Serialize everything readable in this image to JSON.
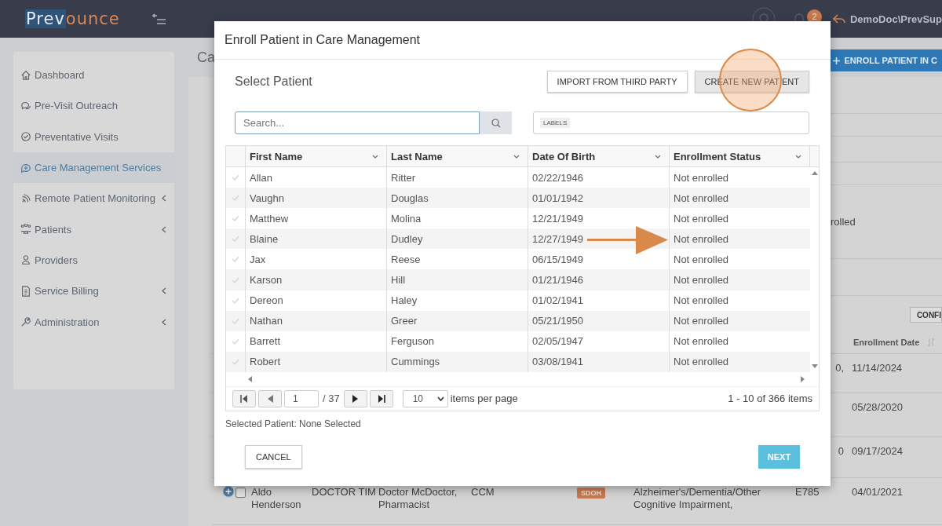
{
  "header": {
    "logo": {
      "part_1": "Prev",
      "part_2": "ounce"
    },
    "notifications": "2",
    "user": "DemoDoc\\PrevSup"
  },
  "sidebar": {
    "items": [
      {
        "label": "Dashboard",
        "expandable": false,
        "selected": false
      },
      {
        "label": "Pre-Visit Outreach",
        "expandable": false,
        "selected": false
      },
      {
        "label": "Preventative Visits",
        "expandable": false,
        "selected": false
      },
      {
        "label": "Care Management Services",
        "expandable": false,
        "selected": true
      },
      {
        "label": "Remote Patient Monitoring",
        "expandable": true,
        "selected": false
      },
      {
        "label": "Patients",
        "expandable": true,
        "selected": false
      },
      {
        "label": "Providers",
        "expandable": false,
        "selected": false
      },
      {
        "label": "Service Billing",
        "expandable": true,
        "selected": false
      },
      {
        "label": "Administration",
        "expandable": true,
        "selected": false
      }
    ]
  },
  "page": {
    "title": "Ca",
    "enroll_button": "ENROLL PATIENT IN C",
    "status_fragment": "rolled",
    "config_button": "CONFI",
    "table": {
      "date_header": "Enrollment Date",
      "rows": [
        {
          "code": "0,",
          "date": "11/14/2024"
        },
        {
          "date": "05/28/2020"
        },
        {
          "code": "0",
          "date": "09/17/2024"
        },
        {
          "checked": false,
          "name": "Aldo Henderson",
          "doctor": "DOCTOR TIM",
          "providers": "Doctor McDoctor, Pharmacist",
          "program": "CCM",
          "tag": "SDOH",
          "condition": "Alzheimer's/Dementia/Other Cognitive Impairment,",
          "code": "E785",
          "date": "04/01/2021"
        }
      ]
    }
  },
  "modal": {
    "title": "Enroll Patient in Care Management",
    "section_title": "Select Patient",
    "import_button": "IMPORT FROM THIRD PARTY",
    "create_button": "CREATE NEW PATIENT",
    "search": {
      "placeholder": "Search..."
    },
    "labels_chip": "LABELS",
    "grid": {
      "columns": [
        "First Name",
        "Last Name",
        "Date Of Birth",
        "Enrollment Status"
      ],
      "rows": [
        {
          "first_name": "Allan",
          "last_name": "Ritter",
          "dob": "02/22/1946",
          "status": "Not enrolled",
          "selected": false
        },
        {
          "first_name": "Vaughn",
          "last_name": "Douglas",
          "dob": "01/01/1942",
          "status": "Not enrolled",
          "selected": false
        },
        {
          "first_name": "Matthew",
          "last_name": "Molina",
          "dob": "12/21/1949",
          "status": "Not enrolled",
          "selected": false
        },
        {
          "first_name": "Blaine",
          "last_name": "Dudley",
          "dob": "12/27/1949",
          "status": "Not enrolled",
          "selected": false
        },
        {
          "first_name": "Jax",
          "last_name": "Reese",
          "dob": "06/15/1949",
          "status": "Not enrolled",
          "selected": false
        },
        {
          "first_name": "Karson",
          "last_name": "Hill",
          "dob": "01/21/1946",
          "status": "Not enrolled",
          "selected": false
        },
        {
          "first_name": "Dereon",
          "last_name": "Haley",
          "dob": "01/02/1941",
          "status": "Not enrolled",
          "selected": false
        },
        {
          "first_name": "Nathan",
          "last_name": "Greer",
          "dob": "05/21/1950",
          "status": "Not enrolled",
          "selected": false
        },
        {
          "first_name": "Barrett",
          "last_name": "Ferguson",
          "dob": "02/05/1947",
          "status": "Not enrolled",
          "selected": false
        },
        {
          "first_name": "Robert",
          "last_name": "Cummings",
          "dob": "03/08/1941",
          "status": "Not enrolled",
          "selected": false
        }
      ]
    },
    "pager": {
      "page": "1",
      "page_count": "/ 37",
      "page_size": "10",
      "per_page_label": "items per page",
      "summary": "1 - 10 of 366 items"
    },
    "selected_patient": "Selected Patient: None Selected",
    "cancel_button": "CANCEL",
    "next_button": "NEXT"
  }
}
